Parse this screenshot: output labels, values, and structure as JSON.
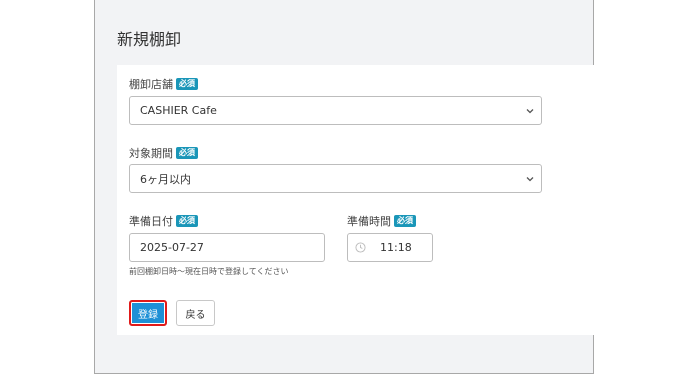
{
  "page": {
    "title": "新規棚卸"
  },
  "form": {
    "store": {
      "label": "棚卸店舗",
      "badge": "必須",
      "value": "CASHIER Cafe"
    },
    "period": {
      "label": "対象期間",
      "badge": "必須",
      "value": "6ヶ月以内"
    },
    "prep_date": {
      "label": "準備日付",
      "badge": "必須",
      "value": "2025-07-27",
      "hint": "前回棚卸日時〜現在日時で登録してください"
    },
    "prep_time": {
      "label": "準備時間",
      "badge": "必須",
      "value": "11:18"
    }
  },
  "buttons": {
    "submit": "登録",
    "back": "戻る"
  },
  "colors": {
    "primary": "#1e90d6",
    "badge": "#1a96b8",
    "highlight": "#e01a1a"
  },
  "icons": {
    "select": "chevron-down-icon",
    "time": "clock-icon"
  }
}
